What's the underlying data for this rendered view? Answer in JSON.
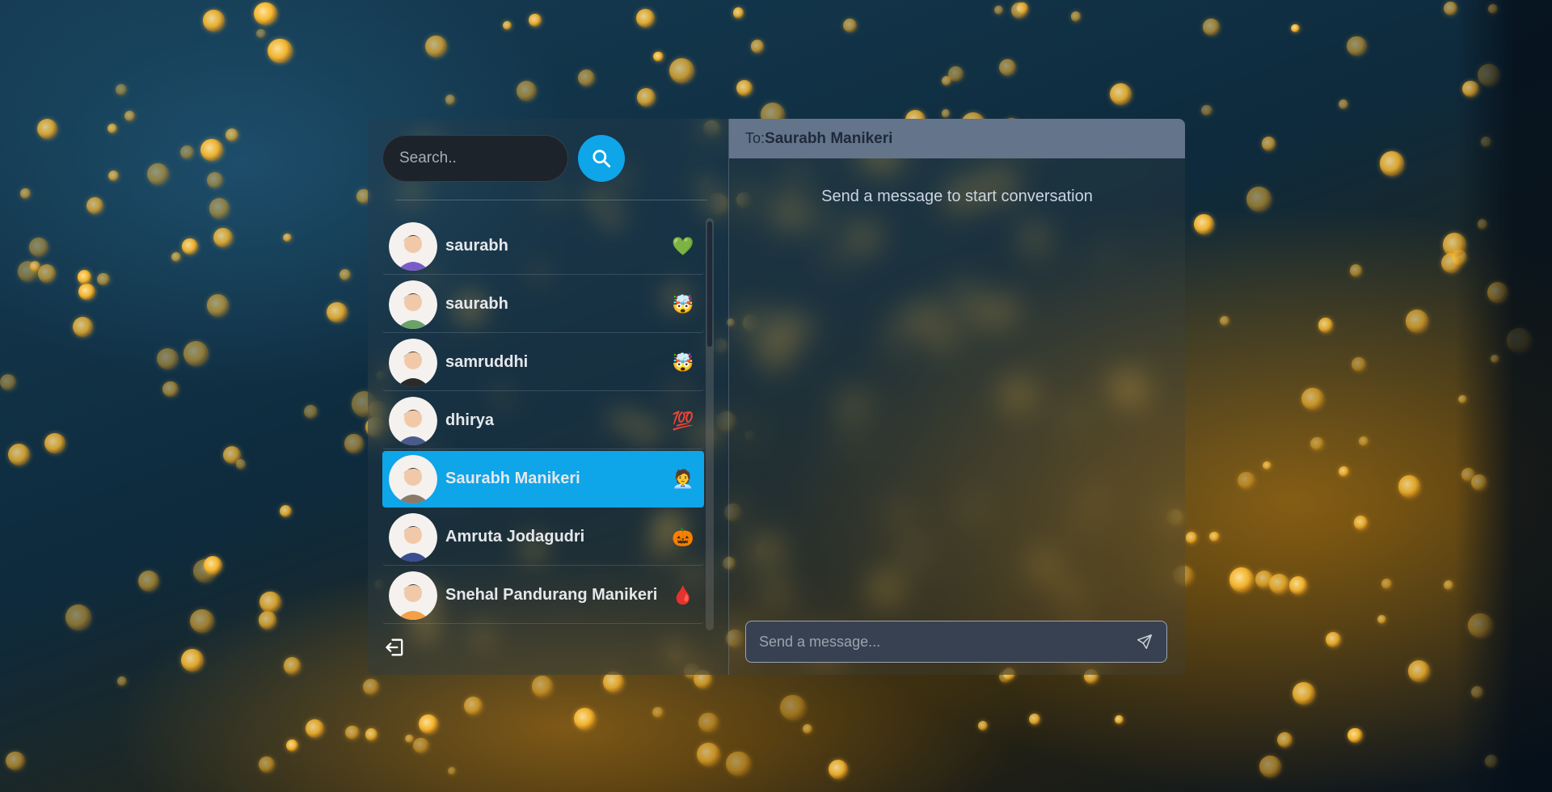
{
  "sidebar": {
    "search": {
      "placeholder": "Search.."
    },
    "contacts": [
      {
        "name": "saurabh",
        "emoji": "💚",
        "active": false
      },
      {
        "name": "saurabh",
        "emoji": "🤯",
        "active": false
      },
      {
        "name": "samruddhi",
        "emoji": "🤯",
        "active": false
      },
      {
        "name": "dhirya",
        "emoji": "💯",
        "active": false
      },
      {
        "name": "Saurabh Manikeri",
        "emoji": "🧑‍💼",
        "active": true
      },
      {
        "name": "Amruta Jodagudri",
        "emoji": "🎃",
        "active": false
      },
      {
        "name": "Snehal Pandurang Manikeri",
        "emoji": "🩸",
        "active": false
      }
    ]
  },
  "chat": {
    "to_label": "To:",
    "recipient": "Saurabh Manikeri",
    "empty_message": "Send a message to start conversation",
    "composer": {
      "placeholder": "Send a message..."
    }
  },
  "icons": {
    "search": "search-icon",
    "logout": "logout-icon",
    "send": "send-icon"
  },
  "colors": {
    "accent": "#0ea5e9",
    "header": "#64748b",
    "input_bg": "#1d232a"
  }
}
